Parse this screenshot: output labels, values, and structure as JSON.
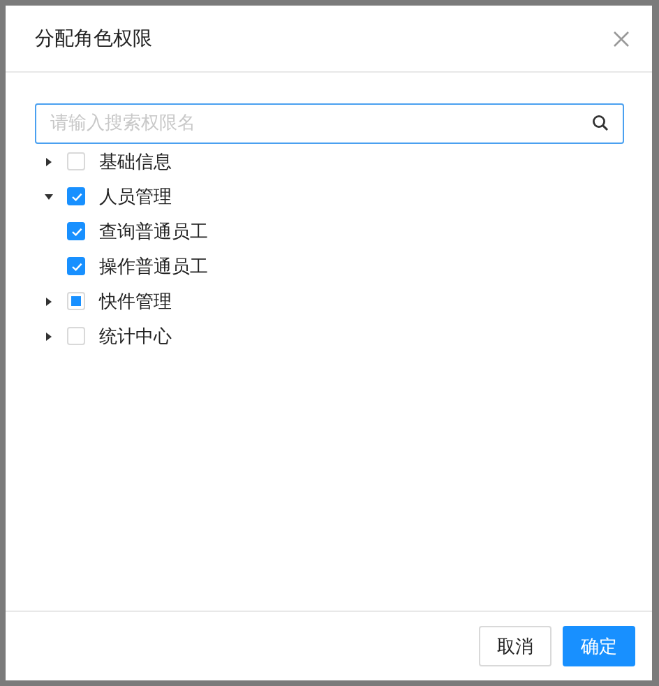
{
  "dialog": {
    "title": "分配角色权限"
  },
  "search": {
    "placeholder": "请输入搜索权限名"
  },
  "tree": [
    {
      "label": "基础信息",
      "checked": false,
      "expanded": false
    },
    {
      "label": "人员管理",
      "checked": true,
      "expanded": true,
      "children": [
        {
          "label": "查询普通员工",
          "checked": true
        },
        {
          "label": "操作普通员工",
          "checked": true
        }
      ]
    },
    {
      "label": "快件管理",
      "checked": false,
      "indeterminate": true,
      "expanded": false
    },
    {
      "label": "统计中心",
      "checked": false,
      "expanded": false
    }
  ],
  "buttons": [
    {
      "label": "取消",
      "kind": "default"
    },
    {
      "label": "确定",
      "kind": "primary"
    }
  ]
}
